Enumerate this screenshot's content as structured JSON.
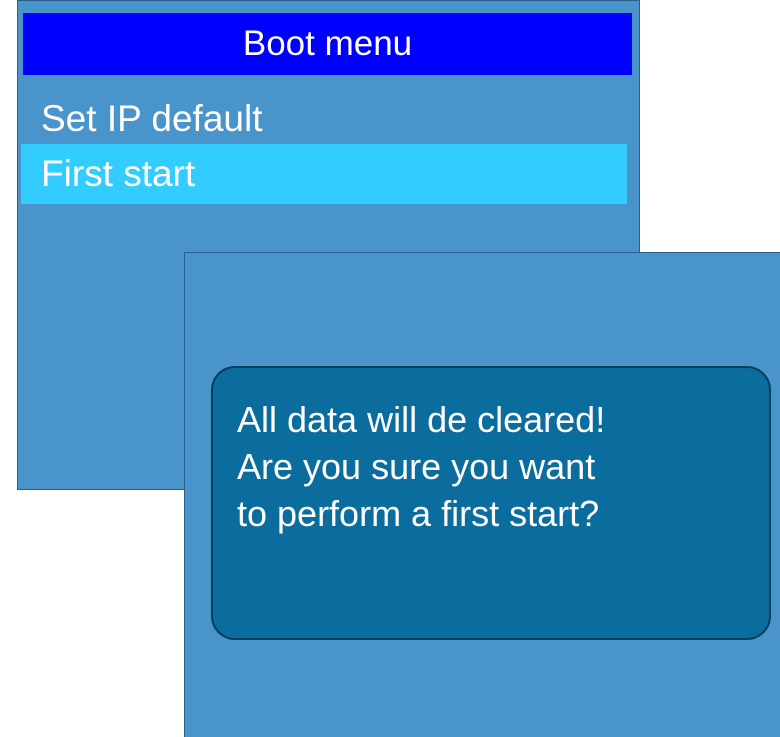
{
  "boot_menu": {
    "title": "Boot menu",
    "items": [
      {
        "label": "Set IP default",
        "selected": false
      },
      {
        "label": "First start",
        "selected": true
      }
    ]
  },
  "dialog": {
    "message_lines": [
      "All data will de cleared!",
      "Are you sure you want",
      "to perform a first start?"
    ]
  },
  "colors": {
    "window_bg": "#4a94cc",
    "title_bg": "#0000ff",
    "selected_bg": "#33ccff",
    "message_bg": "#0b6c9e",
    "text": "#ffffff"
  }
}
